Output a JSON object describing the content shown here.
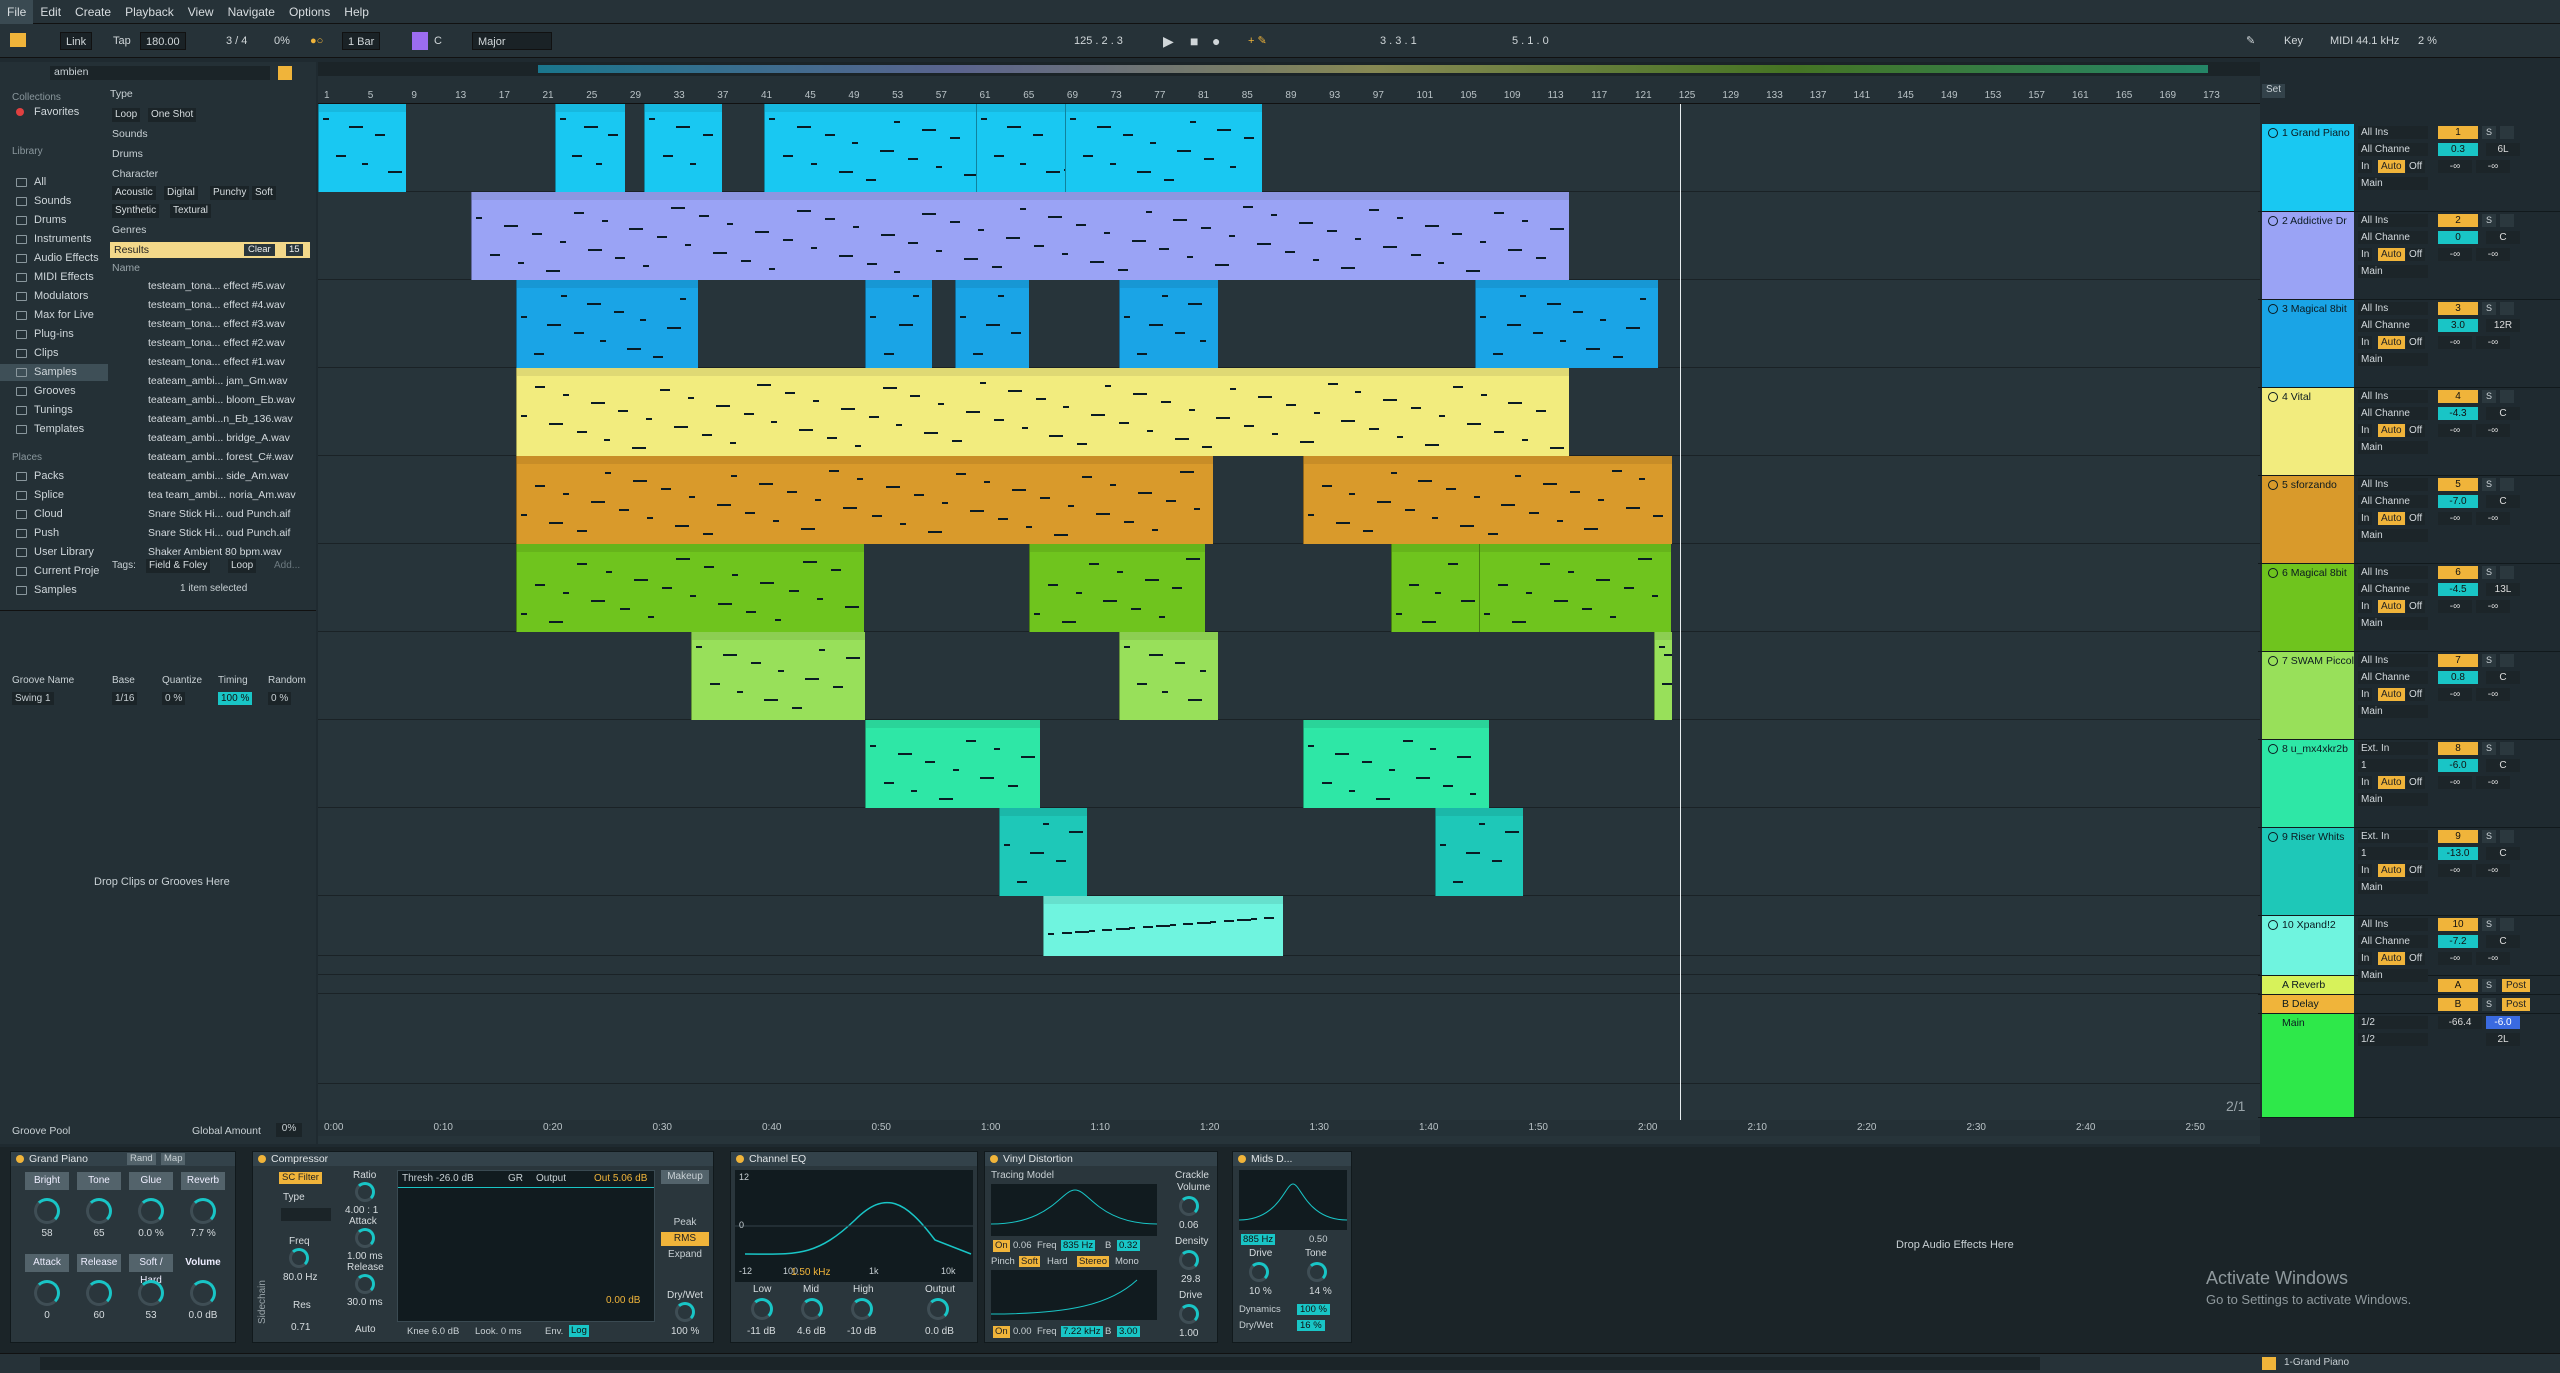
{
  "menu": [
    "File",
    "Edit",
    "Create",
    "Playback",
    "View",
    "Navigate",
    "Options",
    "Help"
  ],
  "transport": {
    "link": "Link",
    "tap": "Tap",
    "tempo": "180.00",
    "sig": "3 / 4",
    "pct": "0%",
    "quant": "1 Bar",
    "key_root": "C",
    "key_scale": "Major",
    "position": "125 . 2 . 3",
    "loop_start": "3 . 3 . 1",
    "loop_len": "5 . 1 . 0",
    "key_label": "Key",
    "midi_label": "MIDI",
    "rate": "44.1 kHz",
    "cpu": "2 %"
  },
  "browser": {
    "search": "ambien",
    "collections_head": "Collections",
    "favorites": "Favorites",
    "library_head": "Library",
    "library": [
      "All",
      "Sounds",
      "Drums",
      "Instruments",
      "Audio Effects",
      "MIDI Effects",
      "Modulators",
      "Max for Live",
      "Plug-ins",
      "Clips",
      "Samples",
      "Grooves",
      "Tunings",
      "Templates"
    ],
    "places_head": "Places",
    "places": [
      "Packs",
      "Splice",
      "Cloud",
      "Push",
      "User Library",
      "Current Proje",
      "Samples"
    ],
    "filters": {
      "type": "Type",
      "loop": "Loop",
      "oneshot": "One Shot",
      "sounds": "Sounds",
      "drums": "Drums",
      "character": "Character",
      "chars": [
        "Acoustic",
        "Digital",
        "Punchy",
        "Soft",
        "Synthetic",
        "Textural"
      ],
      "genres": "Genres",
      "results": "Results",
      "clear": "Clear",
      "count": "15"
    },
    "name_col": "Name",
    "results": [
      "testeam_tona... effect #5.wav",
      "testeam_tona... effect #4.wav",
      "testeam_tona... effect #3.wav",
      "testeam_tona... effect #2.wav",
      "testeam_tona... effect #1.wav",
      "teateam_ambi... jam_Gm.wav",
      "teateam_ambi... bloom_Eb.wav",
      "teateam_ambi...n_Eb_136.wav",
      "teateam_ambi... bridge_A.wav",
      "teateam_ambi... forest_C#.wav",
      "teateam_ambi... side_Am.wav",
      "tea team_ambi... noria_Am.wav",
      "Snare Stick Hi... oud Punch.aif",
      "Snare Stick Hi... oud Punch.aif",
      "Shaker Ambient 80 bpm.wav"
    ],
    "tags_label": "Tags:",
    "tag1": "Field & Foley",
    "tag2": "Loop",
    "tag_add": "Add...",
    "selected": "1 item selected",
    "groove_cols": [
      "Groove Name",
      "Base",
      "Quantize",
      "Timing",
      "Random"
    ],
    "groove_row": [
      "Swing 1",
      "1/16",
      "0 %",
      "100 %",
      "0 %"
    ],
    "drop_text": "Drop Clips or Grooves Here",
    "groove_pool": "Groove Pool",
    "global_amount": "Global Amount",
    "global_val": "0%"
  },
  "ruler": {
    "bars": [
      "1",
      "5",
      "9",
      "13",
      "17",
      "21",
      "25",
      "29",
      "33",
      "37",
      "41",
      "45",
      "49",
      "53",
      "57",
      "61",
      "65",
      "69",
      "73",
      "77",
      "81",
      "85",
      "89",
      "93",
      "97",
      "101",
      "105",
      "109",
      "113",
      "117",
      "121",
      "125",
      "129",
      "133",
      "137",
      "141",
      "145",
      "149",
      "153",
      "157",
      "161",
      "165",
      "169",
      "173"
    ],
    "times": [
      "0:00",
      "0:10",
      "0:20",
      "0:30",
      "0:40",
      "0:50",
      "1:00",
      "1:10",
      "1:20",
      "1:30",
      "1:40",
      "1:50",
      "2:00",
      "2:10",
      "2:20",
      "2:30",
      "2:40",
      "2:50"
    ],
    "set": "Set",
    "page": "2/1"
  },
  "tracks": [
    {
      "name": "1 Grand Piano",
      "color": "#19c8f2",
      "in": "All Ins",
      "ch": "All Channe",
      "vol": "0.3",
      "pan": "6L",
      "num": "1"
    },
    {
      "name": "2 Addictive Dr",
      "color": "#9aa3f5",
      "in": "All Ins",
      "ch": "All Channe",
      "vol": "0",
      "pan": "C",
      "num": "2"
    },
    {
      "name": "3 Magical 8bit",
      "color": "#1aa4e6",
      "in": "All Ins",
      "ch": "All Channe",
      "vol": "3.0",
      "pan": "12R",
      "num": "3"
    },
    {
      "name": "4 Vital",
      "color": "#f2ec7e",
      "in": "All Ins",
      "ch": "All Channe",
      "vol": "-4.3",
      "pan": "C",
      "num": "4"
    },
    {
      "name": "5 sforzando",
      "color": "#d99a2b",
      "in": "All Ins",
      "ch": "All Channe",
      "vol": "-7.0",
      "pan": "C",
      "num": "5"
    },
    {
      "name": "6 Magical 8bit",
      "color": "#6fc41e",
      "in": "All Ins",
      "ch": "All Channe",
      "vol": "-4.5",
      "pan": "13L",
      "num": "6"
    },
    {
      "name": "7 SWAM Piccol",
      "color": "#98e05a",
      "in": "All Ins",
      "ch": "All Channe",
      "vol": "0.8",
      "pan": "C",
      "num": "7"
    },
    {
      "name": "8 u_mx4xkr2b",
      "color": "#2ee7a6",
      "in": "Ext. In",
      "ch": "1",
      "vol": "-6.0",
      "pan": "C",
      "num": "8"
    },
    {
      "name": "9 Riser Whits",
      "color": "#1ec8b8",
      "in": "Ext. In",
      "ch": "1",
      "vol": "-13.0",
      "pan": "C",
      "num": "9"
    },
    {
      "name": "10 Xpand!2",
      "color": "#6ff4df",
      "in": "All Ins",
      "ch": "All Channe",
      "vol": "-7.2",
      "pan": "C",
      "num": "10"
    }
  ],
  "returns": [
    {
      "name": "A Reverb",
      "num": "A",
      "post": "Post"
    },
    {
      "name": "B Delay",
      "num": "B",
      "post": "Post"
    }
  ],
  "main": {
    "name": "Main",
    "out": "1/2",
    "vol": "-66.4",
    "pan": "-6.0",
    "pan2": "2L"
  },
  "mix": {
    "in": "In",
    "auto": "Auto",
    "off": "Off",
    "main": "Main",
    "inf": "-∞",
    "s": "S"
  },
  "devices": {
    "grand": {
      "title": "Grand Piano",
      "rand": "Rand",
      "map": "Map",
      "macros": [
        "Bright",
        "Tone",
        "Glue",
        "Reverb",
        "Attack",
        "Release",
        "Soft / Hard",
        "Volume"
      ],
      "vals": [
        "58",
        "65",
        "0.0 %",
        "7.7 %",
        "0",
        "60",
        "53",
        "0.0 dB"
      ]
    },
    "comp": {
      "title": "Compressor",
      "sc": "SC Filter",
      "type": "Type",
      "freq": "Freq",
      "freq_v": "80.0 Hz",
      "res": "Res",
      "res_v": "0.71",
      "ratio": "Ratio",
      "ratio_v": "4.00 : 1",
      "attack": "Attack",
      "attack_v": "1.00 ms",
      "release": "Release",
      "release_v": "30.0 ms",
      "auto": "Auto",
      "thresh": "Thresh -26.0 dB",
      "gr": "GR",
      "output": "Output",
      "out": "Out 5.06 dB",
      "db": "0.00 dB",
      "makeup": "Makeup",
      "peak": "Peak",
      "rms": "RMS",
      "expand": "Expand",
      "drywet": "Dry/Wet",
      "drywet_v": "100 %",
      "knee": "Knee 6.0 dB",
      "look": "Look. 0 ms",
      "env": "Env.",
      "log": "Log",
      "sidechain": "Sidechain"
    },
    "eq": {
      "title": "Channel EQ",
      "scale": [
        "12",
        "0",
        "-12"
      ],
      "freqs": [
        "100",
        "1k",
        "10k"
      ],
      "freq_v": "1.50 kHz",
      "low": "Low",
      "mid": "Mid",
      "high": "High",
      "output": "Output",
      "low_v": "-11 dB",
      "mid_v": "4.6 dB",
      "high_v": "-10 dB",
      "out_v": "0.0 dB"
    },
    "vinyl": {
      "title": "Vinyl Distortion",
      "model": "Tracing Model",
      "crackle": "Crackle",
      "volume": "Volume",
      "vol_v": "0.06",
      "density": "Density",
      "dens_v": "29.8",
      "drive": "Drive",
      "drive_v": "1.00",
      "on": "On",
      "v1": "0.06",
      "freq": "Freq",
      "f1": "835 Hz",
      "b": "B",
      "b1": "0.32",
      "soft": "Soft",
      "hard": "Hard",
      "stereo": "Stereo",
      "mono": "Mono",
      "pinch": "Pinch",
      "v2": "0.00",
      "f2": "7.22 kHz",
      "b2": "3.00"
    },
    "mids": {
      "title": "Mids D...",
      "hz": "885 Hz",
      "v": "0.50",
      "drive": "Drive",
      "tone": "Tone",
      "drive_v": "10 %",
      "tone_v": "14 %",
      "dyn": "Dynamics",
      "dyn_v": "100 %",
      "dw": "Dry/Wet",
      "dw_v": "16 %"
    },
    "drop": "Drop Audio Effects Here"
  },
  "watermark": {
    "title": "Activate Windows",
    "sub": "Go to Settings to activate Windows."
  },
  "status": {
    "track": "1-Grand Piano"
  }
}
